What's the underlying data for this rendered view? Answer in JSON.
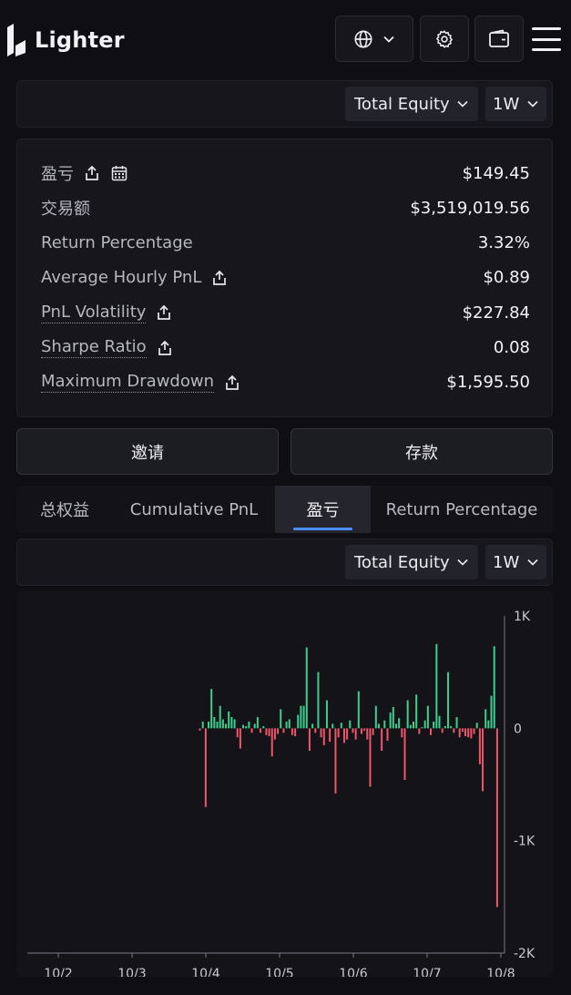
{
  "app": {
    "name": "Lighter"
  },
  "header": {
    "language_icon": "globe-icon",
    "settings_icon": "gear-icon",
    "wallet_icon": "wallet-icon",
    "menu_icon": "hamburger-menu-icon"
  },
  "top_filter": {
    "metric": "Total Equity",
    "range": "1W"
  },
  "stats": [
    {
      "label": "盈亏",
      "value": "$149.45",
      "dotted": false,
      "share": true,
      "calendar": true
    },
    {
      "label": "交易额",
      "value": "$3,519,019.56",
      "dotted": false,
      "share": false,
      "calendar": false
    },
    {
      "label": "Return Percentage",
      "value": "3.32%",
      "dotted": false,
      "share": false,
      "calendar": false
    },
    {
      "label": "Average Hourly PnL",
      "value": "$0.89",
      "dotted": false,
      "share": true,
      "calendar": false
    },
    {
      "label": "PnL Volatility",
      "value": "$227.84",
      "dotted": true,
      "share": true,
      "calendar": false
    },
    {
      "label": "Sharpe Ratio",
      "value": "0.08",
      "dotted": true,
      "share": true,
      "calendar": false
    },
    {
      "label": "Maximum Drawdown",
      "value": "$1,595.50",
      "dotted": true,
      "share": true,
      "calendar": false
    }
  ],
  "actions": {
    "invite": "邀请",
    "deposit": "存款"
  },
  "tabs": [
    {
      "label": "总权益",
      "active": false
    },
    {
      "label": "Cumulative PnL",
      "active": false
    },
    {
      "label": "盈亏",
      "active": true
    },
    {
      "label": "Return Percentage",
      "active": false
    }
  ],
  "chart_filter": {
    "metric": "Total Equity",
    "range": "1W"
  },
  "colors": {
    "positive": "#3ecf8e",
    "negative": "#f0566a",
    "accent": "#4c8dff"
  },
  "chart_data": {
    "type": "bar",
    "x_ticks": [
      "10/2",
      "10/3",
      "10/4",
      "10/5",
      "10/6",
      "10/7",
      "10/8"
    ],
    "y_ticks": [
      {
        "label": "1K",
        "value": 1000
      },
      {
        "label": "0",
        "value": 0
      },
      {
        "label": "-1K",
        "value": -1000
      },
      {
        "label": "-2K",
        "value": -2000
      }
    ],
    "ylim": [
      -2000,
      1000
    ],
    "x_range": [
      1.58,
      8.05
    ],
    "grid": false,
    "values": [
      -20,
      60,
      -700,
      60,
      350,
      100,
      60,
      200,
      80,
      40,
      150,
      100,
      80,
      -80,
      -180,
      30,
      20,
      60,
      -40,
      40,
      100,
      -40,
      20,
      -60,
      -70,
      -250,
      -100,
      -50,
      170,
      -40,
      60,
      80,
      -60,
      -70,
      120,
      200,
      200,
      720,
      -200,
      40,
      -40,
      500,
      -80,
      -150,
      250,
      -120,
      40,
      -580,
      -80,
      50,
      -130,
      -100,
      70,
      -40,
      -100,
      330,
      -50,
      -20,
      -100,
      -520,
      -60,
      200,
      40,
      -200,
      70,
      -110,
      140,
      190,
      40,
      90,
      -80,
      -460,
      250,
      30,
      60,
      300,
      -50,
      10,
      70,
      200,
      -60,
      60,
      750,
      110,
      -40,
      20,
      500,
      20,
      -40,
      100,
      -80,
      -30,
      -70,
      -80,
      -90,
      -50,
      50,
      -320,
      -560,
      170,
      70,
      290,
      730,
      -1590
    ],
    "x_start": 3.92,
    "x_end": 7.95
  }
}
